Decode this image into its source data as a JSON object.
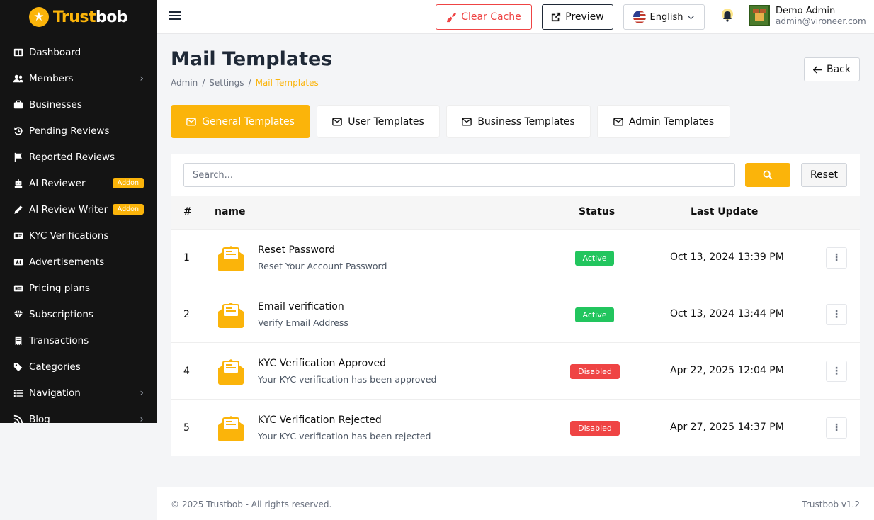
{
  "brand": {
    "name_part1": "Trust",
    "name_part2": "bob",
    "accent": "#fbb40a"
  },
  "sidebar": {
    "items": [
      {
        "label": "Dashboard",
        "icon": "dashboard-icon"
      },
      {
        "label": "Members",
        "icon": "users-icon",
        "has_submenu": true
      },
      {
        "label": "Businesses",
        "icon": "briefcase-icon"
      },
      {
        "label": "Pending Reviews",
        "icon": "history-icon"
      },
      {
        "label": "Reported Reviews",
        "icon": "flag-icon"
      },
      {
        "label": "AI Reviewer",
        "icon": "robot-icon",
        "badge": "Addon"
      },
      {
        "label": "AI Review Writer",
        "icon": "pencil-icon",
        "badge": "Addon"
      },
      {
        "label": "KYC Verifications",
        "icon": "id-card-icon"
      },
      {
        "label": "Advertisements",
        "icon": "ad-icon"
      },
      {
        "label": "Pricing plans",
        "icon": "pricing-icon"
      },
      {
        "label": "Subscriptions",
        "icon": "gem-icon"
      },
      {
        "label": "Transactions",
        "icon": "receipt-icon"
      },
      {
        "label": "Categories",
        "icon": "tags-icon"
      },
      {
        "label": "Navigation",
        "icon": "list-icon",
        "has_submenu": true
      },
      {
        "label": "Blog",
        "icon": "rss-icon",
        "has_submenu": true
      }
    ]
  },
  "topbar": {
    "clear_cache": "Clear Cache",
    "preview": "Preview",
    "language": "English",
    "user_name": "Demo Admin",
    "user_email": "admin@vironeer.com"
  },
  "page": {
    "title": "Mail Templates",
    "breadcrumb": [
      "Admin",
      "Settings",
      "Mail Templates"
    ],
    "back": "Back"
  },
  "tabs": [
    {
      "label": "General Templates",
      "active": true
    },
    {
      "label": "User Templates",
      "active": false
    },
    {
      "label": "Business Templates",
      "active": false
    },
    {
      "label": "Admin Templates",
      "active": false
    }
  ],
  "search": {
    "placeholder": "Search...",
    "reset": "Reset"
  },
  "table": {
    "columns": {
      "num": "#",
      "name": "name",
      "status": "Status",
      "last_update": "Last Update"
    },
    "rows": [
      {
        "num": "1",
        "name": "Reset Password",
        "description": "Reset Your Account Password",
        "status": "Active",
        "updated": "Oct 13, 2024 13:39 PM"
      },
      {
        "num": "2",
        "name": "Email verification",
        "description": "Verify Email Address",
        "status": "Active",
        "updated": "Oct 13, 2024 13:44 PM"
      },
      {
        "num": "4",
        "name": "KYC Verification Approved",
        "description": "Your KYC verification has been approved",
        "status": "Disabled",
        "updated": "Apr 22, 2025 12:04 PM"
      },
      {
        "num": "5",
        "name": "KYC Verification Rejected",
        "description": "Your KYC verification has been rejected",
        "status": "Disabled",
        "updated": "Apr 27, 2025 14:37 PM"
      }
    ]
  },
  "footer": {
    "copyright": "© 2025 Trustbob - All rights reserved.",
    "version": "Trustbob v1.2"
  },
  "colors": {
    "active": "#22c55e",
    "disabled": "#ef4444",
    "danger": "#ef4444",
    "sidebar_bg": "#141414"
  }
}
